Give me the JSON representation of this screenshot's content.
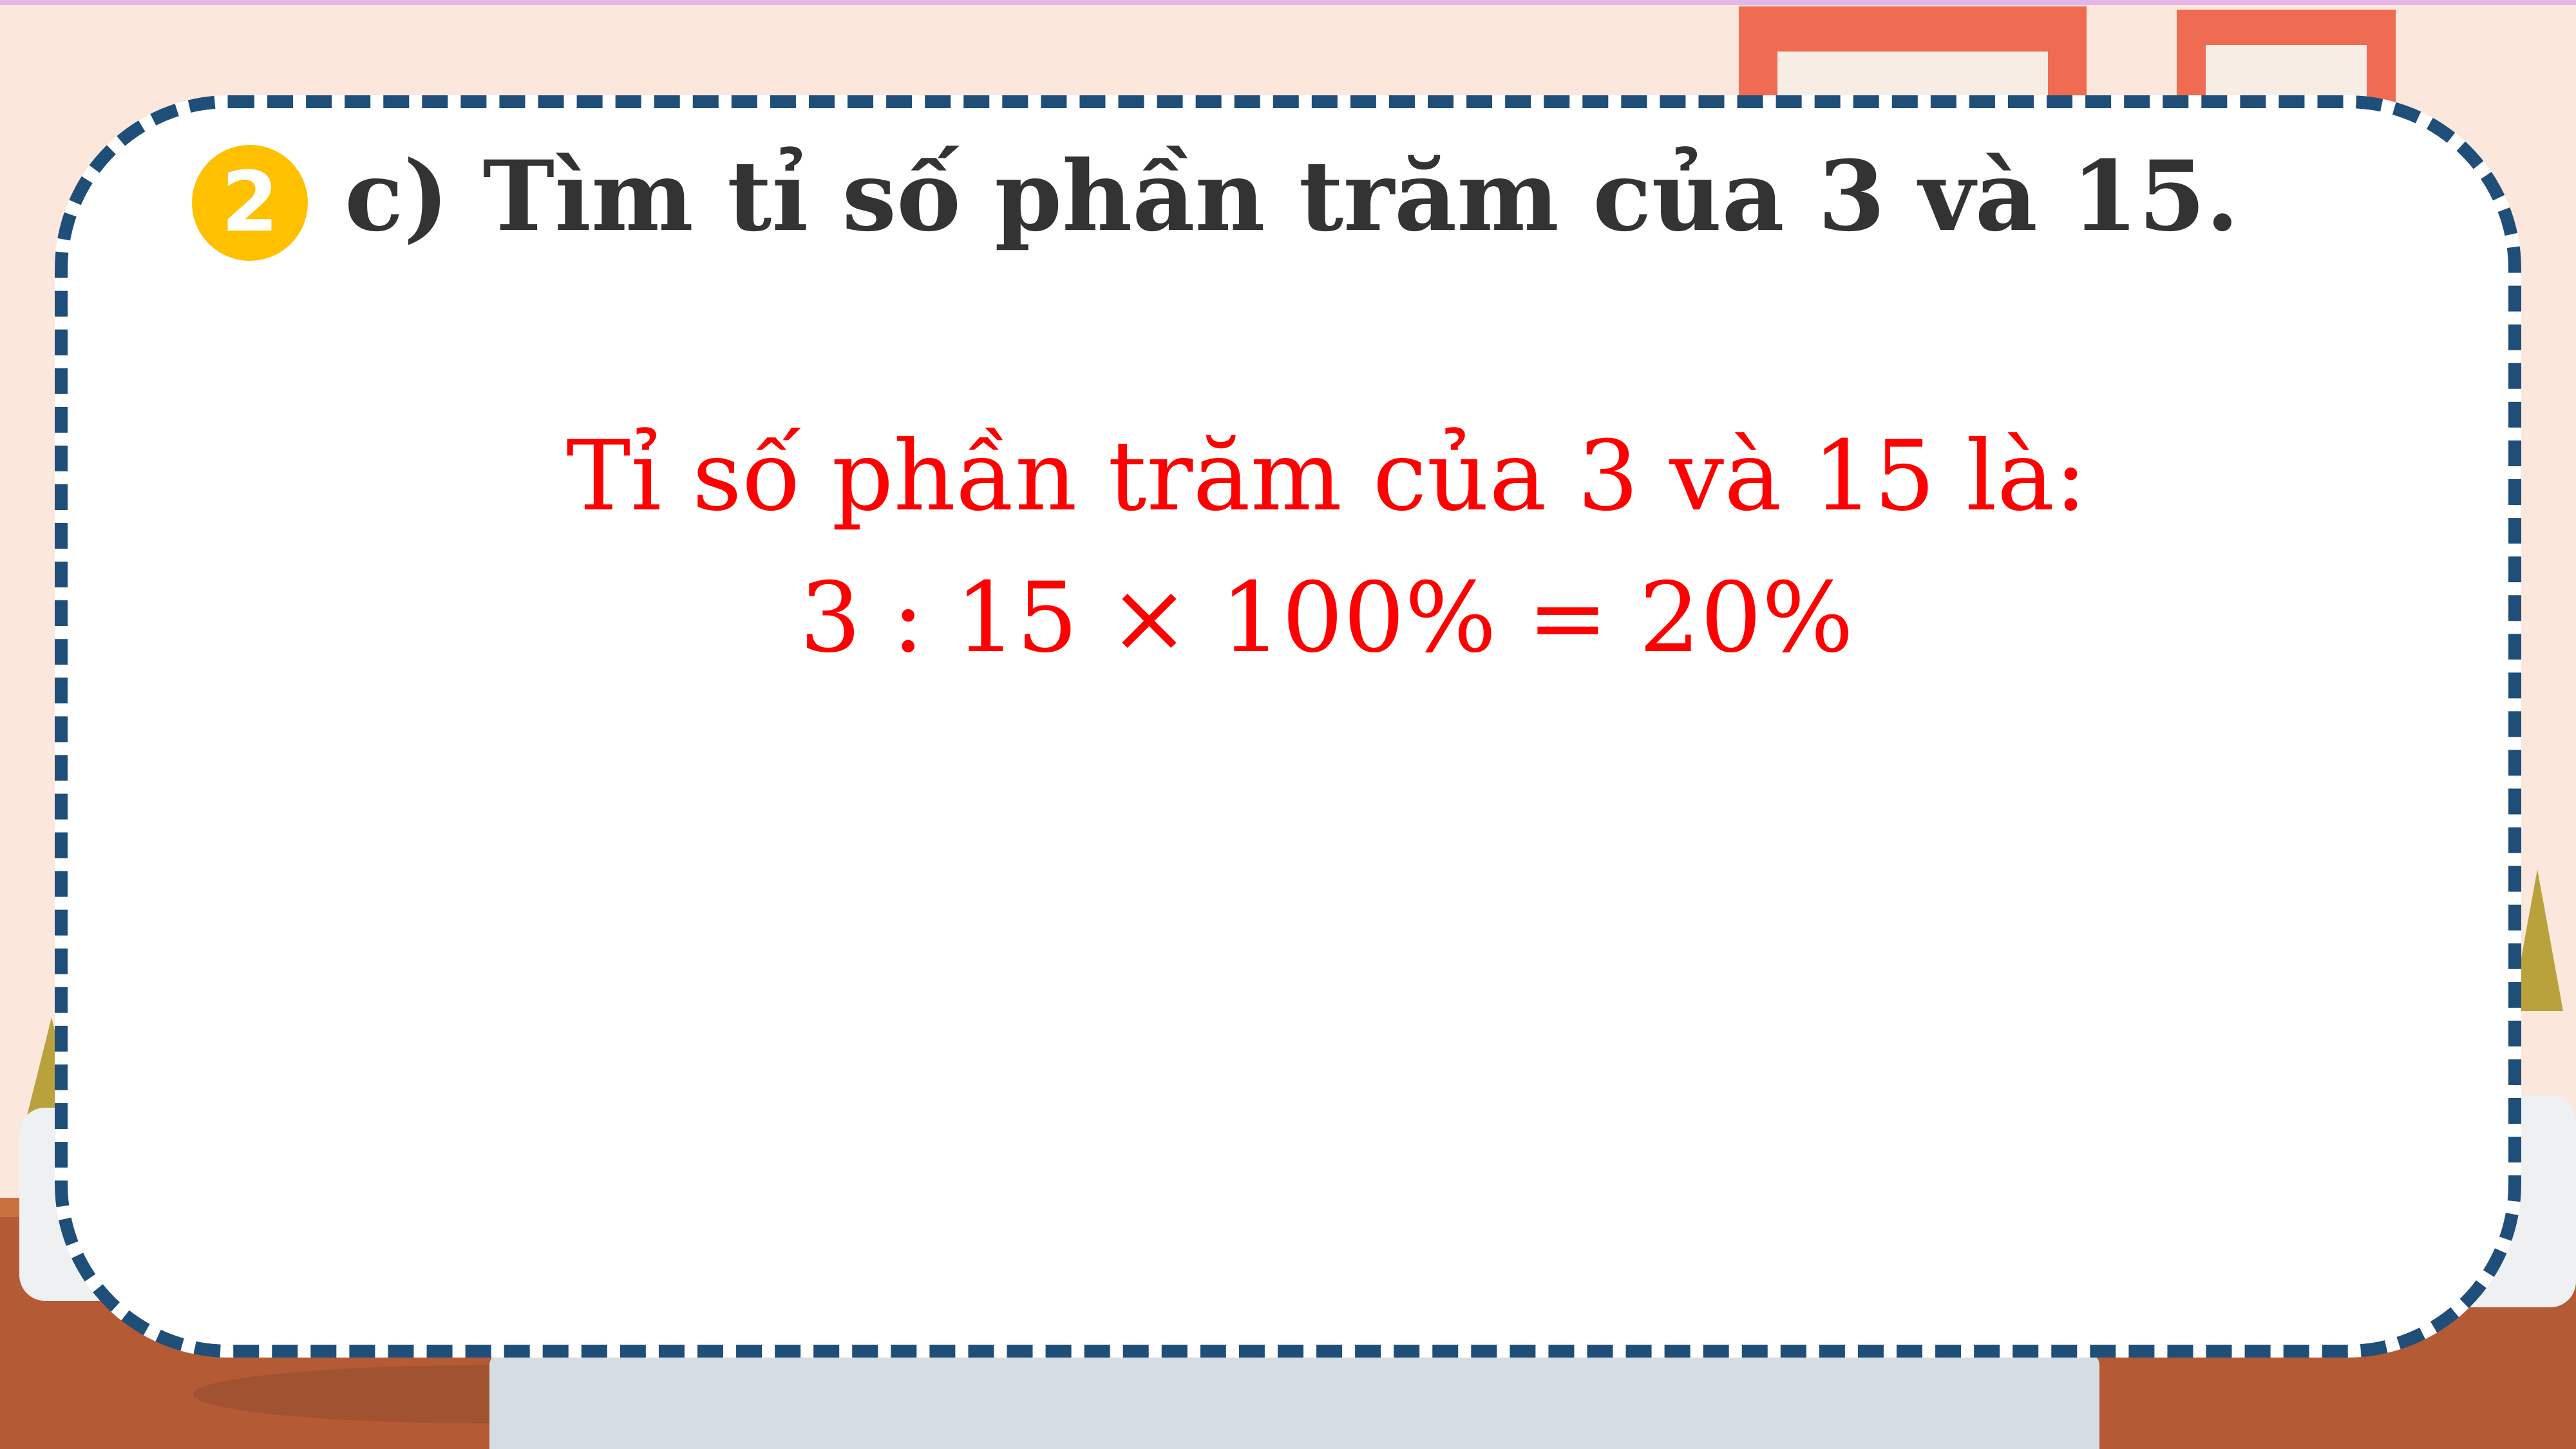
{
  "question": {
    "number": "2",
    "text": "c) Tìm tỉ số phần trăm của 3 và 15."
  },
  "answer": {
    "line1": "Tỉ số phần trăm của 3 và 15 là:",
    "line2": "3 : 15 × 100% = 20%"
  },
  "colors": {
    "badge": "#ffc000",
    "answer": "#ff0000",
    "border": "#1f4e79",
    "question": "#333333"
  }
}
